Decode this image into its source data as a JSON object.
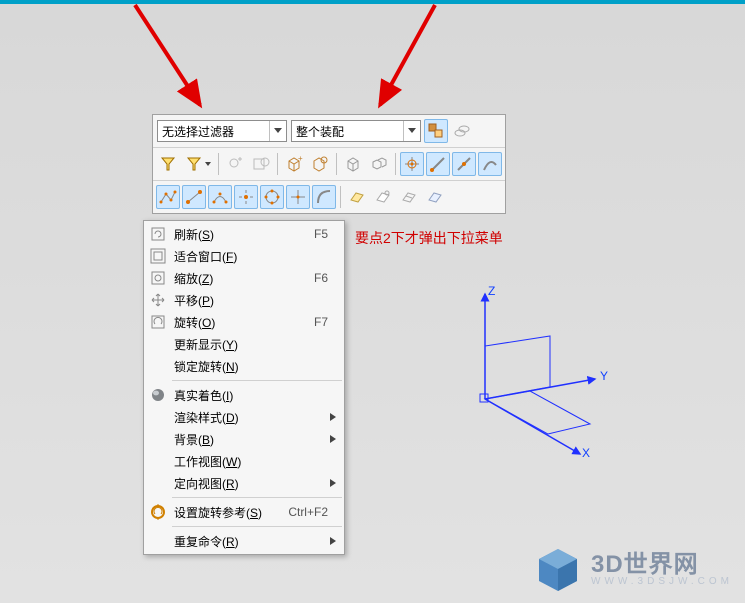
{
  "selects": {
    "filter": "无选择过滤器",
    "scope": "整个装配"
  },
  "menu": [
    {
      "label": "刷新",
      "u": "S",
      "shortcut": "F5",
      "icon": "refresh",
      "sep": false
    },
    {
      "label": "适合窗口",
      "u": "F",
      "shortcut": "",
      "icon": "fit",
      "sep": false
    },
    {
      "label": "缩放",
      "u": "Z",
      "shortcut": "F6",
      "icon": "zoom",
      "sep": false
    },
    {
      "label": "平移",
      "u": "P",
      "shortcut": "",
      "icon": "pan",
      "sep": false
    },
    {
      "label": "旋转",
      "u": "O",
      "shortcut": "F7",
      "icon": "rotate",
      "sep": false
    },
    {
      "label": "更新显示",
      "u": "Y",
      "shortcut": "",
      "icon": "",
      "sep": false
    },
    {
      "label": "锁定旋转",
      "u": "N",
      "shortcut": "",
      "icon": "",
      "sep": true
    },
    {
      "label": "真实着色",
      "u": "I",
      "shortcut": "",
      "icon": "shade",
      "sep": false
    },
    {
      "label": "渲染样式",
      "u": "D",
      "shortcut": "",
      "icon": "",
      "sub": true,
      "sep": false
    },
    {
      "label": "背景",
      "u": "B",
      "shortcut": "",
      "icon": "",
      "sub": true,
      "sep": false
    },
    {
      "label": "工作视图",
      "u": "W",
      "shortcut": "",
      "icon": "",
      "sep": false
    },
    {
      "label": "定向视图",
      "u": "R",
      "shortcut": "",
      "icon": "",
      "sub": true,
      "sep": true
    },
    {
      "label": "设置旋转参考",
      "u": "S",
      "shortcut": "Ctrl+F2",
      "icon": "setref",
      "sep": true
    },
    {
      "label": "重复命令",
      "u": "R",
      "shortcut": "",
      "icon": "",
      "sub": true,
      "sep": false
    }
  ],
  "note": "要点2下才弹出下拉菜单",
  "axes": {
    "x": "X",
    "y": "Y",
    "z": "Z"
  },
  "watermark": {
    "title": "3D世界网",
    "url": "WWW.3DSJW.COM"
  }
}
